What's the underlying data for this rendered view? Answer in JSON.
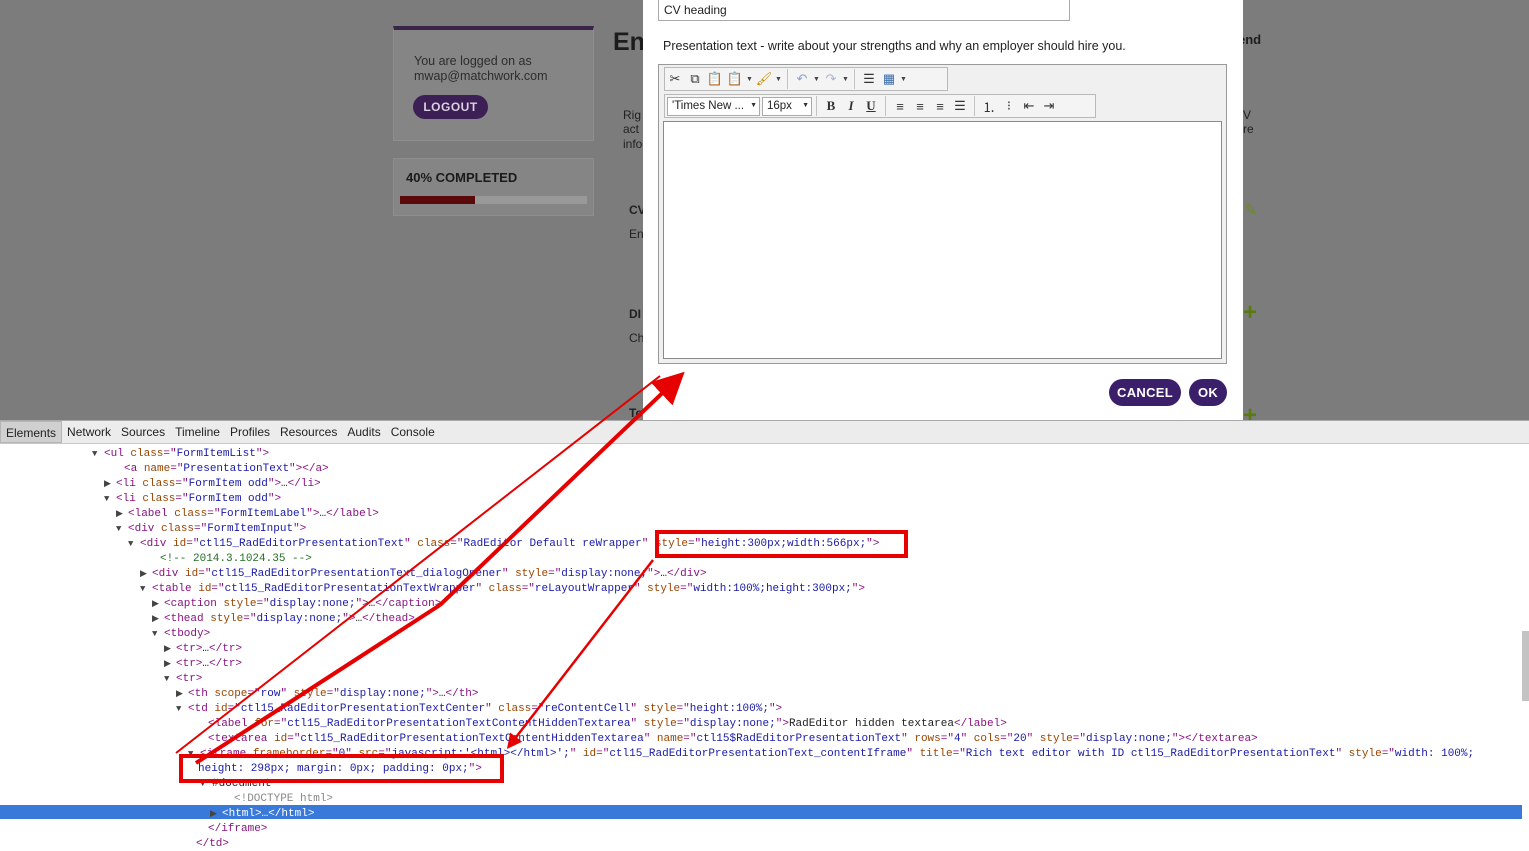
{
  "background_page": {
    "login_text": "You are logged on as mwap@matchwork.com",
    "logout_label": "LOGOUT",
    "progress_label": "40% COMPLETED",
    "progress_fraction": 0.4,
    "heading_fragment": "En",
    "right_fragment": "end",
    "text_fragments": [
      "Rig",
      "act",
      "info",
      "CV",
      "En",
      "DI",
      "Ch",
      "V",
      "re",
      "To"
    ]
  },
  "modal": {
    "cv_heading_value": "CV heading",
    "presentation_label": "Presentation text - write about your strengths and why an employer should hire you.",
    "font_name": "'Times New ...",
    "font_size": "16px",
    "bold": "B",
    "italic": "I",
    "underline": "U",
    "cancel_label": "CANCEL",
    "ok_label": "OK"
  },
  "devtools": {
    "tabs": [
      "Elements",
      "Network",
      "Sources",
      "Timeline",
      "Profiles",
      "Resources",
      "Audits",
      "Console"
    ],
    "active_tab": "Elements",
    "lines": [
      {
        "tri": "▼",
        "indent": 104,
        "html": "<span class='t'>&lt;ul </span><span class='a'>class</span><span class='t'>=\"</span><span class='v'>FormItemList</span><span class='t'>\"&gt;</span>"
      },
      {
        "tri": "",
        "indent": 124,
        "html": "<span class='t'>&lt;a </span><span class='a'>name</span><span class='t'>=\"</span><span class='v'>PresentationText</span><span class='t'>\"&gt;&lt;/a&gt;</span>"
      },
      {
        "tri": "▶",
        "indent": 116,
        "html": "<span class='t'>&lt;li </span><span class='a'>class</span><span class='t'>=\"</span><span class='v'>FormItem odd</span><span class='t'>\"&gt;</span><span class='p'>…</span><span class='t'>&lt;/li&gt;</span>"
      },
      {
        "tri": "▼",
        "indent": 116,
        "html": "<span class='t'>&lt;li </span><span class='a'>class</span><span class='t'>=\"</span><span class='v'>FormItem odd</span><span class='t'>\"&gt;</span>"
      },
      {
        "tri": "▶",
        "indent": 128,
        "html": "<span class='t'>&lt;label </span><span class='a'>class</span><span class='t'>=\"</span><span class='v'>FormItemLabel</span><span class='t'>\"&gt;</span><span class='p'>…</span><span class='t'>&lt;/label&gt;</span>"
      },
      {
        "tri": "▼",
        "indent": 128,
        "html": "<span class='t'>&lt;div </span><span class='a'>class</span><span class='t'>=\"</span><span class='v'>FormItemInput</span><span class='t'>\"&gt;</span>"
      },
      {
        "tri": "▼",
        "indent": 140,
        "html": "<span class='t'>&lt;div </span><span class='a'>id</span><span class='t'>=\"</span><span class='v'>ctl15_RadEditorPresentationText</span><span class='t'>\" </span><span class='a'>class</span><span class='t'>=\"</span><span class='v'>RadEditor Default reWrapper</span><span class='t'>\" </span><span class='a'>style</span><span class='t'>=\"</span><span class='v'>height:300px;width:566px;</span><span class='t'>\"&gt;</span>"
      },
      {
        "tri": "",
        "indent": 160,
        "html": "<span class='c'>&lt;!-- 2014.3.1024.35 --&gt;</span>"
      },
      {
        "tri": "▶",
        "indent": 152,
        "html": "<span class='t'>&lt;div </span><span class='a'>id</span><span class='t'>=\"</span><span class='v'>ctl15_RadEditorPresentationText_dialogOpener</span><span class='t'>\" </span><span class='a'>style</span><span class='t'>=\"</span><span class='v'>display:none;</span><span class='t'>\"&gt;</span><span class='p'>…</span><span class='t'>&lt;/div&gt;</span>"
      },
      {
        "tri": "▼",
        "indent": 152,
        "html": "<span class='t'>&lt;table </span><span class='a'>id</span><span class='t'>=\"</span><span class='v'>ctl15_RadEditorPresentationTextWrapper</span><span class='t'>\" </span><span class='a'>class</span><span class='t'>=\"</span><span class='v'>reLayoutWrapper</span><span class='t'>\" </span><span class='a'>style</span><span class='t'>=\"</span><span class='v'>width:100%;height:300px;</span><span class='t'>\"&gt;</span>"
      },
      {
        "tri": "▶",
        "indent": 164,
        "html": "<span class='t'>&lt;caption </span><span class='a'>style</span><span class='t'>=\"</span><span class='v'>display:none;</span><span class='t'>\"&gt;</span><span class='p'>…</span><span class='t'>&lt;/caption&gt;</span>"
      },
      {
        "tri": "▶",
        "indent": 164,
        "html": "<span class='t'>&lt;thead </span><span class='a'>style</span><span class='t'>=\"</span><span class='v'>display:none;</span><span class='t'>\"&gt;</span><span class='p'>…</span><span class='t'>&lt;/thead&gt;</span>"
      },
      {
        "tri": "▼",
        "indent": 164,
        "html": "<span class='t'>&lt;tbody&gt;</span>"
      },
      {
        "tri": "▶",
        "indent": 176,
        "html": "<span class='t'>&lt;tr&gt;</span><span class='p'>…</span><span class='t'>&lt;/tr&gt;</span>"
      },
      {
        "tri": "▶",
        "indent": 176,
        "html": "<span class='t'>&lt;tr&gt;</span><span class='p'>…</span><span class='t'>&lt;/tr&gt;</span>"
      },
      {
        "tri": "▼",
        "indent": 176,
        "html": "<span class='t'>&lt;tr&gt;</span>"
      },
      {
        "tri": "▶",
        "indent": 188,
        "html": "<span class='t'>&lt;th </span><span class='a'>scope</span><span class='t'>=\"</span><span class='v'>row</span><span class='t'>\" </span><span class='a'>style</span><span class='t'>=\"</span><span class='v'>display:none;</span><span class='t'>\"&gt;</span><span class='p'>…</span><span class='t'>&lt;/th&gt;</span>"
      },
      {
        "tri": "▼",
        "indent": 188,
        "html": "<span class='t'>&lt;td </span><span class='a'>id</span><span class='t'>=\"</span><span class='v'>ctl15_RadEditorPresentationTextCenter</span><span class='t'>\" </span><span class='a'>class</span><span class='t'>=\"</span><span class='v'>reContentCell</span><span class='t'>\" </span><span class='a'>style</span><span class='t'>=\"</span><span class='v'>height:100%;</span><span class='t'>\"&gt;</span>"
      },
      {
        "tri": "",
        "indent": 208,
        "html": "<span class='t'>&lt;label </span><span class='a'>for</span><span class='t'>=\"</span><span class='v'>ctl15_RadEditorPresentationTextContentHiddenTextarea</span><span class='t'>\" </span><span class='a'>style</span><span class='t'>=\"</span><span class='v'>display:none;</span><span class='t'>\"&gt;</span><span class='p'>RadEditor hidden textarea</span><span class='t'>&lt;/label&gt;</span>"
      },
      {
        "tri": "",
        "indent": 208,
        "html": "<span class='t'>&lt;textarea </span><span class='a'>id</span><span class='t'>=\"</span><span class='v'>ctl15_RadEditorPresentationTextContentHiddenTextarea</span><span class='t'>\" </span><span class='a'>name</span><span class='t'>=\"</span><span class='v'>ctl15$RadEditorPresentationText</span><span class='t'>\" </span><span class='a'>rows</span><span class='t'>=\"</span><span class='v'>4</span><span class='t'>\" </span><span class='a'>cols</span><span class='t'>=\"</span><span class='v'>20</span><span class='t'>\" </span><span class='a'>style</span><span class='t'>=\"</span><span class='v'>display:none;</span><span class='t'>\"&gt;&lt;/textarea&gt;</span>"
      },
      {
        "tri": "▼",
        "indent": 200,
        "html": "<span class='t'>&lt;iframe </span><span class='a'>frameborder</span><span class='t'>=\"</span><span class='v'>0</span><span class='t'>\" </span><span class='a'>src</span><span class='t'>=\"</span><span class='v'>javascript:'&lt;html&gt;&lt;/html&gt;';</span><span class='t'>\" </span><span class='a'>id</span><span class='t'>=\"</span><span class='v'>ctl15_RadEditorPresentationText_contentIframe</span><span class='t'>\" </span><span class='a'>title</span><span class='t'>=\"</span><span class='v'>Rich text editor with ID ctl15_RadEditorPresentationText</span><span class='t'>\" </span><span class='a'>style</span><span class='t'>=\"</span><span class='v'>width: 100%;</span>"
      },
      {
        "tri": "",
        "indent": 198,
        "html": "<span class='v'>height: 298px; margin: 0px; padding: 0px;</span><span class='t'>\"&gt;</span>"
      },
      {
        "tri": "▼",
        "indent": 212,
        "html": "<span class='p'>#document</span>"
      },
      {
        "tri": "",
        "indent": 234,
        "html": "<span class='dg'>&lt;!DOCTYPE html&gt;</span>"
      },
      {
        "tri": "▶",
        "indent": 222,
        "html": "<span style='color:#fff'>&lt;html&gt;…&lt;/html&gt;</span>"
      },
      {
        "tri": "",
        "indent": 208,
        "html": "<span class='t'>&lt;/iframe&gt;</span>"
      },
      {
        "tri": "",
        "indent": 196,
        "html": "<span class='t'>&lt;/td&gt;</span>"
      }
    ]
  },
  "colors": {
    "annotation_red": "#e60000",
    "modal_button": "#3c1f6b",
    "progress_fill": "#5a0a0a",
    "selected_row": "#3879d9"
  }
}
